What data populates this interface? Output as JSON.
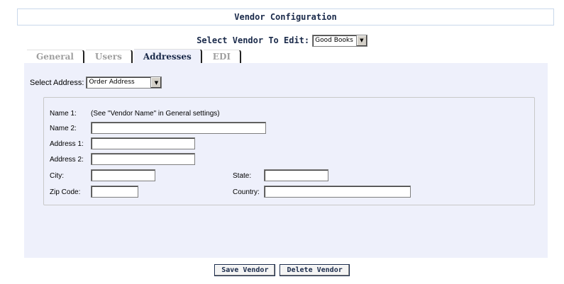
{
  "header": {
    "title": "Vendor Configuration"
  },
  "vendor_select": {
    "label": "Select Vendor To Edit:",
    "value": "Good Books"
  },
  "tabs": [
    {
      "label": "General",
      "active": false
    },
    {
      "label": "Users",
      "active": false
    },
    {
      "label": "Addresses",
      "active": true
    },
    {
      "label": "EDI",
      "active": false
    }
  ],
  "address_select": {
    "label": "Select Address:",
    "value": "Order Address"
  },
  "form": {
    "name1_label": "Name 1:",
    "name1_value": "(See \"Vendor Name\" in General settings)",
    "name2_label": "Name 2:",
    "address1_label": "Address 1:",
    "address2_label": "Address 2:",
    "city_label": "City:",
    "state_label": "State:",
    "zip_label": "Zip Code:",
    "country_label": "Country:"
  },
  "buttons": {
    "save": "Save Vendor",
    "delete": "Delete Vendor"
  },
  "colors": {
    "panel_bg": "#eef0fb",
    "accent": "#1a2a4a"
  }
}
